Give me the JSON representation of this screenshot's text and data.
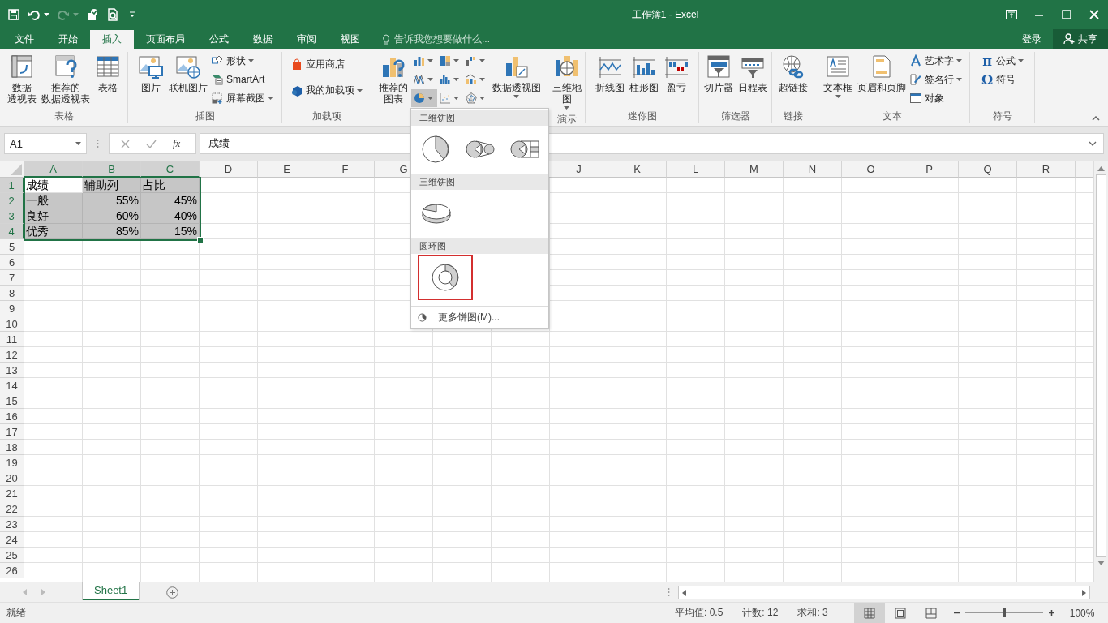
{
  "title": "工作簿1 - Excel",
  "quick_access": [
    {
      "disabled": false
    },
    {
      "disabled": false
    },
    {
      "disabled": true
    },
    {
      "disabled": false
    },
    {
      "disabled": false
    }
  ],
  "tabs": [
    {
      "label": "文件",
      "selected": false
    },
    {
      "label": "开始",
      "selected": false
    },
    {
      "label": "插入",
      "selected": true
    },
    {
      "label": "页面布局",
      "selected": false
    },
    {
      "label": "公式",
      "selected": false
    },
    {
      "label": "数据",
      "selected": false
    },
    {
      "label": "审阅",
      "selected": false
    },
    {
      "label": "视图",
      "selected": false
    }
  ],
  "tell_me": {
    "placeholder": "告诉我您想要做什么..."
  },
  "sign_in": "登录",
  "share": "共享",
  "ribbon": {
    "groups": [
      {
        "label": "表格",
        "items": [
          {
            "kind": "large",
            "lines": [
              "数据",
              "透视表"
            ]
          },
          {
            "kind": "large",
            "lines": [
              "推荐的",
              "数据透视表"
            ]
          },
          {
            "kind": "large",
            "lines": [
              "表格"
            ]
          }
        ]
      },
      {
        "label": "插图",
        "items": [
          {
            "kind": "large",
            "lines": [
              "图片"
            ]
          },
          {
            "kind": "large",
            "lines": [
              "联机图片"
            ]
          },
          {
            "kind": "small",
            "label": "形状",
            "dropdown": true
          },
          {
            "kind": "small",
            "label": "SmartArt"
          },
          {
            "kind": "small",
            "label": "屏幕截图",
            "dropdown": true
          }
        ]
      },
      {
        "label": "加载项",
        "items": [
          {
            "kind": "wide",
            "label": "应用商店"
          },
          {
            "kind": "wide",
            "label": "我的加载项",
            "dropdown": true
          }
        ]
      },
      {
        "items": [
          {
            "kind": "large",
            "lines": [
              "推荐的",
              "图表"
            ]
          },
          {
            "kind": "chart_grid",
            "buttons": [
              {
                "selected": false
              },
              {
                "selected": false
              },
              {
                "selected": false
              },
              {
                "selected": false
              },
              {
                "selected": false
              },
              {
                "selected": false
              },
              {
                "selected": true
              },
              {
                "selected": false
              },
              {
                "selected": false
              }
            ]
          },
          {
            "kind": "large",
            "lines": [
              "数据透视图"
            ],
            "dropdown": true
          }
        ]
      },
      {
        "label": "演示",
        "items": [
          {
            "kind": "large",
            "lines": [
              "三维地",
              "图"
            ],
            "dropdown": true
          }
        ]
      },
      {
        "label": "迷你图",
        "items": [
          {
            "kind": "large",
            "lines": [
              "折线图"
            ]
          },
          {
            "kind": "large",
            "lines": [
              "柱形图"
            ]
          },
          {
            "kind": "large",
            "lines": [
              "盈亏"
            ]
          }
        ]
      },
      {
        "label": "筛选器",
        "items": [
          {
            "kind": "large",
            "lines": [
              "切片器"
            ]
          },
          {
            "kind": "large",
            "lines": [
              "日程表"
            ]
          }
        ]
      },
      {
        "label": "链接",
        "items": [
          {
            "kind": "large",
            "lines": [
              "超链接"
            ]
          }
        ]
      },
      {
        "label": "文本",
        "items": [
          {
            "kind": "large",
            "lines": [
              "文本框"
            ],
            "dropdown": true
          },
          {
            "kind": "large",
            "lines": [
              "页眉和页脚"
            ]
          },
          {
            "kind": "small",
            "label": "艺术字",
            "dropdown": true
          },
          {
            "kind": "small",
            "label": "签名行",
            "dropdown": true
          },
          {
            "kind": "small",
            "label": "对象"
          }
        ]
      },
      {
        "label": "符号",
        "items": [
          {
            "kind": "small",
            "label": "公式",
            "glyph": "π",
            "dropdown": true
          },
          {
            "kind": "small",
            "label": "符号",
            "glyph": "Ω"
          }
        ]
      }
    ]
  },
  "formula_bar": {
    "name_box": "A1",
    "function_label": "fx",
    "formula": "成绩"
  },
  "sheet": {
    "columns": [
      {
        "label": "A",
        "selected": true
      },
      {
        "label": "B",
        "selected": true
      },
      {
        "label": "C",
        "selected": true
      },
      {
        "label": "D",
        "selected": false
      },
      {
        "label": "E",
        "selected": false
      },
      {
        "label": "F",
        "selected": false
      },
      {
        "label": "G",
        "selected": false
      },
      {},
      {},
      {
        "label": "J",
        "selected": false
      },
      {
        "label": "K",
        "selected": false
      },
      {
        "label": "L",
        "selected": false
      },
      {
        "label": "M",
        "selected": false
      },
      {
        "label": "N",
        "selected": false
      },
      {
        "label": "O",
        "selected": false
      },
      {
        "label": "P",
        "selected": false
      },
      {
        "label": "Q",
        "selected": false
      },
      {
        "label": "R",
        "selected": false
      }
    ],
    "rows": [
      {
        "label": "1",
        "selected": true,
        "cells": [
          {
            "text": "成绩",
            "kind": "text"
          },
          {
            "text": "辅助列",
            "kind": "text"
          },
          {
            "text": "占比",
            "kind": "text"
          }
        ]
      },
      {
        "label": "2",
        "selected": true,
        "cells": [
          {
            "text": "一般",
            "kind": "text"
          },
          {
            "text": "55%",
            "kind": "number"
          },
          {
            "text": "45%",
            "kind": "number"
          }
        ]
      },
      {
        "label": "3",
        "selected": true,
        "cells": [
          {
            "text": "良好",
            "kind": "text"
          },
          {
            "text": "60%",
            "kind": "number"
          },
          {
            "text": "40%",
            "kind": "number"
          }
        ]
      },
      {
        "label": "4",
        "selected": true,
        "cells": [
          {
            "text": "优秀",
            "kind": "text"
          },
          {
            "text": "85%",
            "kind": "number"
          },
          {
            "text": "15%",
            "kind": "number"
          }
        ]
      },
      {
        "label": "5",
        "selected": false
      },
      {
        "label": "6",
        "selected": false
      },
      {
        "label": "7",
        "selected": false
      },
      {
        "label": "8",
        "selected": false
      },
      {
        "label": "9",
        "selected": false
      },
      {
        "label": "10",
        "selected": false
      },
      {
        "label": "11",
        "selected": false
      },
      {
        "label": "12",
        "selected": false
      },
      {
        "label": "13",
        "selected": false
      },
      {
        "label": "14",
        "selected": false
      },
      {
        "label": "15",
        "selected": false
      },
      {
        "label": "16",
        "selected": false
      },
      {
        "label": "17",
        "selected": false
      },
      {
        "label": "18",
        "selected": false
      },
      {
        "label": "19",
        "selected": false
      },
      {
        "label": "20",
        "selected": false
      },
      {
        "label": "21",
        "selected": false
      },
      {
        "label": "22",
        "selected": false
      },
      {
        "label": "23",
        "selected": false
      },
      {
        "label": "24",
        "selected": false
      },
      {
        "label": "25",
        "selected": false
      },
      {
        "label": "26",
        "selected": false
      }
    ]
  },
  "pie_menu": {
    "sections": [
      {
        "title": "二维饼图",
        "options": [
          {
            "selected": false
          },
          {
            "selected": false
          },
          {
            "selected": false
          }
        ]
      },
      {
        "title": "三维饼图",
        "options": [
          {
            "selected": false
          }
        ]
      },
      {
        "title": "圆环图",
        "options": [
          {
            "selected": true
          }
        ]
      }
    ],
    "more": "更多饼图(M)..."
  },
  "sheet_tabs": [
    {
      "label": "Sheet1",
      "selected": true
    }
  ],
  "status_bar": {
    "status": "就绪",
    "stats": [
      "平均值: 0.5",
      "计数: 12",
      "求和: 3"
    ],
    "views": [
      {
        "selected": true
      },
      {
        "selected": false
      },
      {
        "selected": false
      }
    ],
    "zoom": {
      "level": 0.5,
      "reading": "100%"
    }
  }
}
